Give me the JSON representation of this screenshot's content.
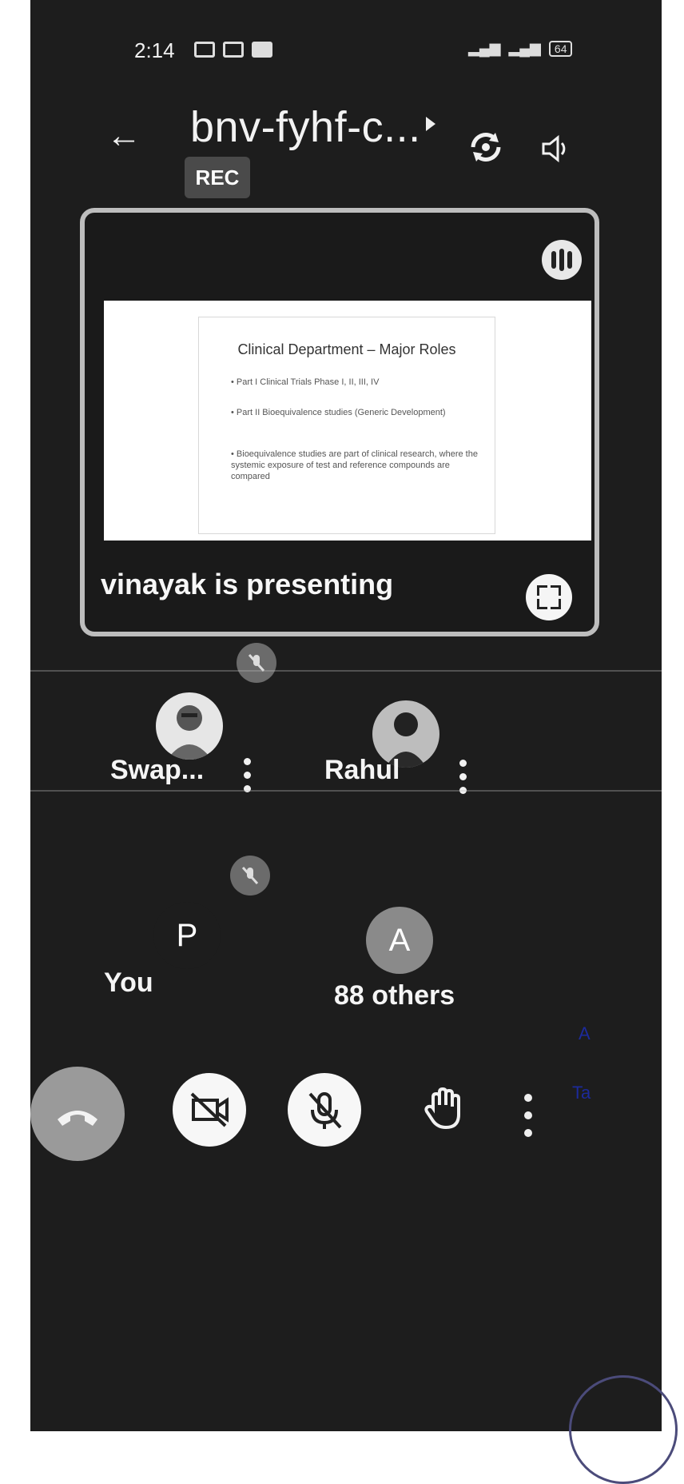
{
  "status_bar": {
    "time": "2:14",
    "battery": "64"
  },
  "header": {
    "meeting_code": "bnv-fyhf-c...",
    "rec_badge": "REC"
  },
  "presentation": {
    "slide": {
      "title": "Clinical Department – Major Roles",
      "bullets": [
        "• Part I Clinical Trials Phase I, II, III, IV",
        "• Part II Bioequivalence studies (Generic Development)",
        "• Bioequivalence studies are part of clinical research, where the systemic exposure of test and reference compounds are compared"
      ]
    },
    "presenting_text": "vinayak is presenting"
  },
  "participants": [
    {
      "name": "Swap...",
      "avatar": "photo"
    },
    {
      "name": "Rahul",
      "avatar": "photo"
    },
    {
      "name": "You",
      "avatar_letter": "P",
      "avatar_color": "#1d1d1d"
    },
    {
      "name": "88 others",
      "avatar_letter": "A",
      "avatar_color": "#8a8a8a"
    }
  ],
  "controls": {
    "hangup": "hangup-icon",
    "camera": "video-off-icon",
    "mic": "mic-off-icon",
    "raise_hand": "hand-icon",
    "more": "more-vert-icon"
  },
  "margin_marks": {
    "a": "A",
    "t": "Ta"
  }
}
